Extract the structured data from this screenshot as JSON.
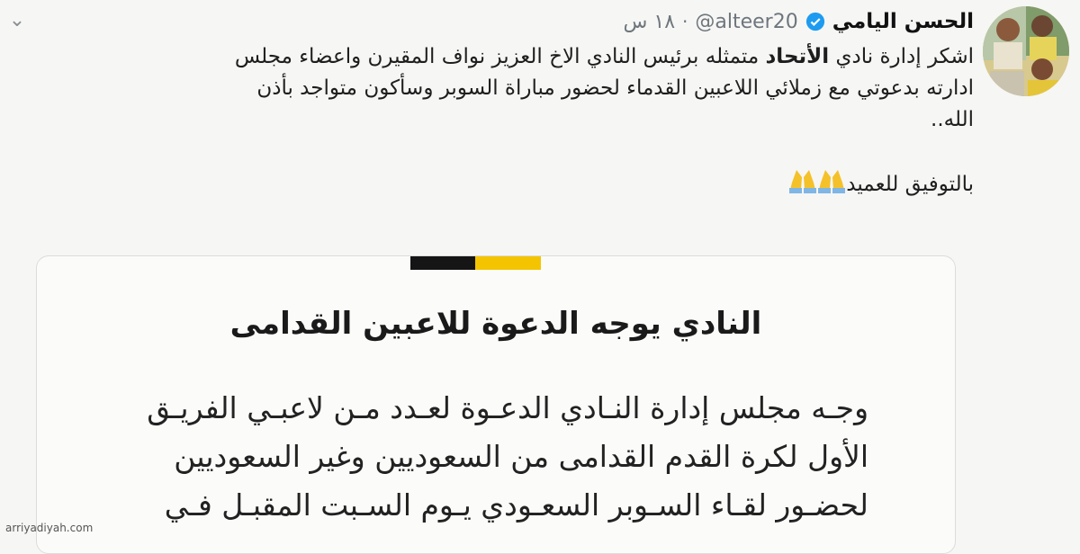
{
  "tweet": {
    "author_name": "الحسن اليامي",
    "handle": "@alteer20",
    "separator": "·",
    "timestamp": "١٨ س",
    "text_lines": [
      [
        "اشكر إدارة نادي ",
        "الأتحاد",
        " متمثله برئيس النادي الاخ العزيز نواف المقيرن واعضاء مجلس"
      ],
      "ادارته بدعوتي مع زملائي اللاعبين القدماء لحضور مباراة السوبر وسأكون متواجد بأذن",
      "الله..",
      "بالتوفيق للعميد"
    ],
    "emoji": [
      "folded-hands-icon",
      "folded-hands-icon"
    ]
  },
  "card": {
    "brand_colors": [
      "#151515",
      "#f4c400"
    ],
    "title": "النادي يوجه الدعوة للاعبين القدامى",
    "body_lines": [
      "وجـه مجلس إدارة النـادي الدعـوة لعـدد مـن لاعبـي الفريـق",
      "الأول لكرة القدم القدامى من السعوديين وغير السعوديين",
      "لحضـور لقـاء السـوبر السعـودي يـوم السـبت المقبـل فـي"
    ]
  },
  "watermark": "arriyadiyah.com"
}
